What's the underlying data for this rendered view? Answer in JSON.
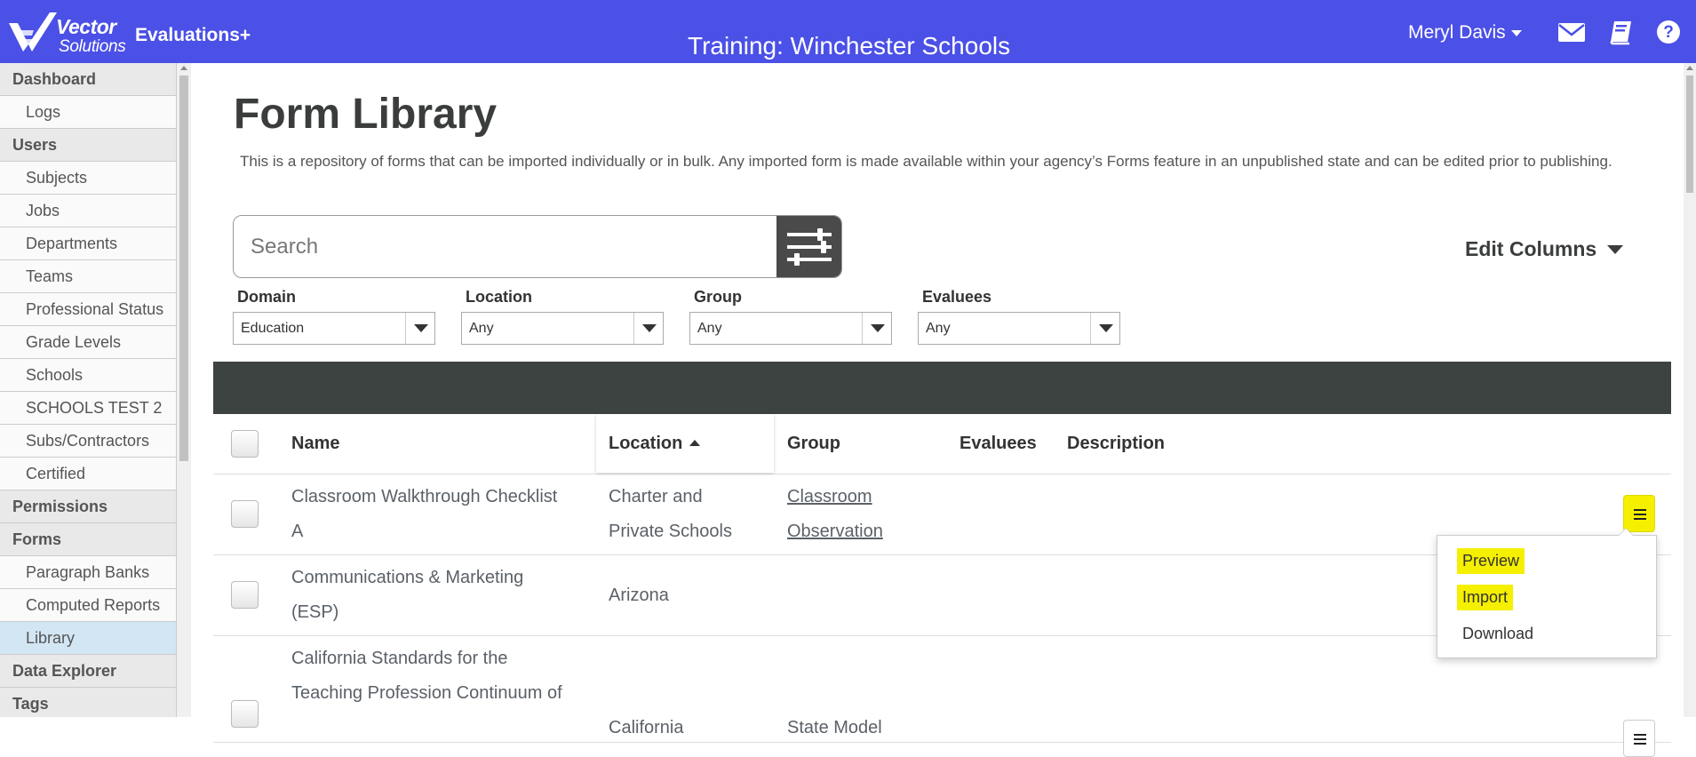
{
  "header": {
    "logo_line1": "Vector",
    "logo_line2": "Solutions",
    "app_name": "Evaluations+",
    "environment_title": "Training: Winchester Schools",
    "user_name": "Meryl Davis",
    "icons": [
      "mail-icon",
      "book-icon",
      "help-icon"
    ],
    "brand_color": "#4b50e6"
  },
  "sidebar": {
    "items": [
      {
        "label": "Dashboard",
        "type": "section"
      },
      {
        "label": "Logs",
        "type": "item"
      },
      {
        "label": "Users",
        "type": "section"
      },
      {
        "label": "Subjects",
        "type": "item"
      },
      {
        "label": "Jobs",
        "type": "item"
      },
      {
        "label": "Departments",
        "type": "item"
      },
      {
        "label": "Teams",
        "type": "item"
      },
      {
        "label": "Professional Status",
        "type": "item"
      },
      {
        "label": "Grade Levels",
        "type": "item"
      },
      {
        "label": "Schools",
        "type": "item"
      },
      {
        "label": "SCHOOLS TEST 2",
        "type": "item"
      },
      {
        "label": "Subs/Contractors",
        "type": "item"
      },
      {
        "label": "Certified",
        "type": "item"
      },
      {
        "label": "Permissions",
        "type": "section"
      },
      {
        "label": "Forms",
        "type": "section"
      },
      {
        "label": "Paragraph Banks",
        "type": "item"
      },
      {
        "label": "Computed Reports",
        "type": "item"
      },
      {
        "label": "Library",
        "type": "item",
        "active": true
      },
      {
        "label": "Data Explorer",
        "type": "section"
      },
      {
        "label": "Tags",
        "type": "section"
      }
    ]
  },
  "main": {
    "title": "Form Library",
    "description": "This is a repository of forms that can be imported individually or in bulk. Any imported form is made available within your agency’s Forms feature in an unpublished state and can be edited prior to publishing.",
    "search": {
      "placeholder": "Search",
      "value": ""
    },
    "edit_columns_label": "Edit Columns",
    "filters": [
      {
        "label": "Domain",
        "value": "Education"
      },
      {
        "label": "Location",
        "value": "Any"
      },
      {
        "label": "Group",
        "value": "Any"
      },
      {
        "label": "Evaluees",
        "value": "Any"
      }
    ],
    "table": {
      "columns": [
        "Name",
        "Location",
        "Group",
        "Evaluees",
        "Description"
      ],
      "sorted_column": "Location",
      "sort_direction": "ascending",
      "rows": [
        {
          "name_lines": [
            "Classroom Walkthrough Checklist",
            "A"
          ],
          "location_lines": [
            "Charter and",
            "Private Schools"
          ],
          "group_lines": [
            "Classroom",
            "Observation"
          ],
          "evaluees": "",
          "description": ""
        },
        {
          "name_lines": [
            "Communications & Marketing",
            "(ESP)"
          ],
          "location_lines": [
            "Arizona"
          ],
          "group_lines": [],
          "evaluees": "",
          "description": ""
        },
        {
          "name_lines": [
            "California Standards for the",
            "Teaching Profession Continuum of"
          ],
          "location_lines": [
            "California"
          ],
          "group_lines": [
            "State Model"
          ],
          "evaluees": "",
          "description": ""
        }
      ]
    },
    "row_menu": {
      "items": [
        {
          "label": "Preview",
          "highlighted": true
        },
        {
          "label": "Import",
          "highlighted": true
        },
        {
          "label": "Download",
          "highlighted": false
        }
      ]
    }
  }
}
